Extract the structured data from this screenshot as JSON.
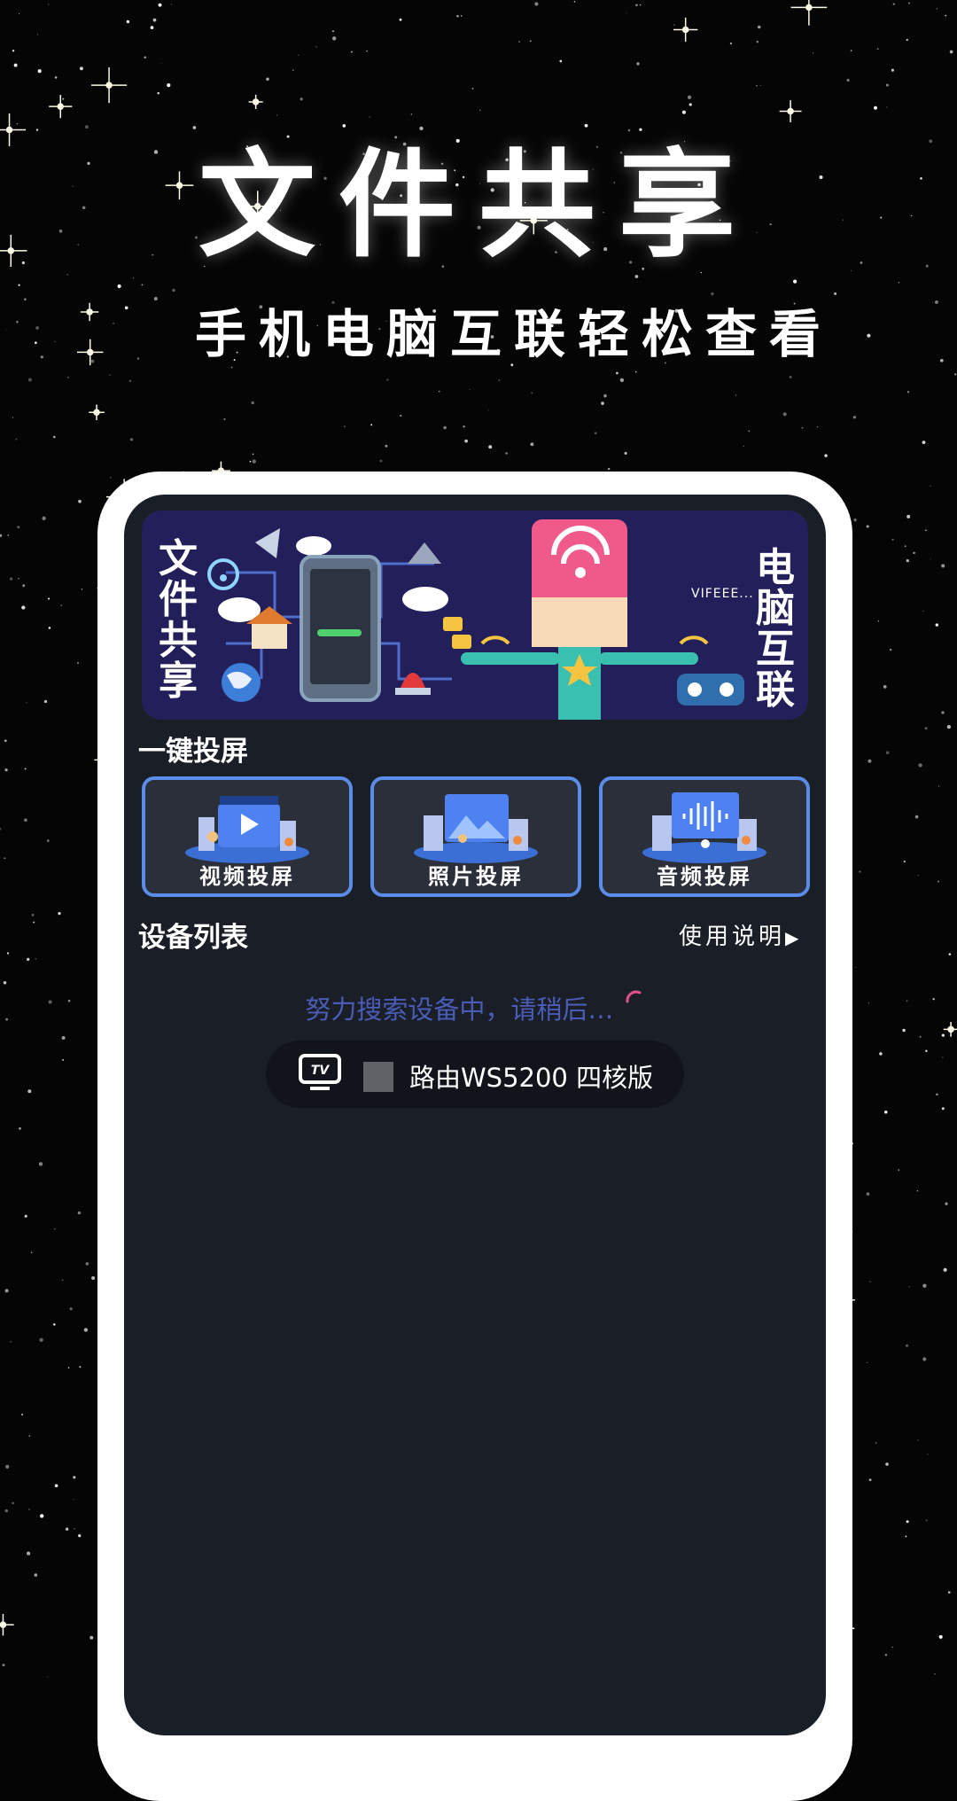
{
  "hero": {
    "title": "文件共享",
    "subtitle": "手机电脑互联轻松查看"
  },
  "banner": {
    "left_text": "文件共享",
    "right_text": "电脑互联",
    "tag": "VIFEEE..."
  },
  "cast_section": {
    "title": "一键投屏",
    "cards": [
      {
        "label": "视频投屏",
        "icon": "video-cast-icon"
      },
      {
        "label": "照片投屏",
        "icon": "photo-cast-icon"
      },
      {
        "label": "音频投屏",
        "icon": "audio-cast-icon"
      }
    ]
  },
  "device_section": {
    "title": "设备列表",
    "help_label": "使用说明",
    "searching_text": "努力搜索设备中，请稍后…",
    "device_name": "路由WS5200 四核版",
    "device_icon_text": "TV"
  },
  "colors": {
    "screen_bg": "#1a1f27",
    "card_border": "#5b8de8",
    "searching_text": "#4a5cb8",
    "banner_bg": "#221f5a"
  }
}
